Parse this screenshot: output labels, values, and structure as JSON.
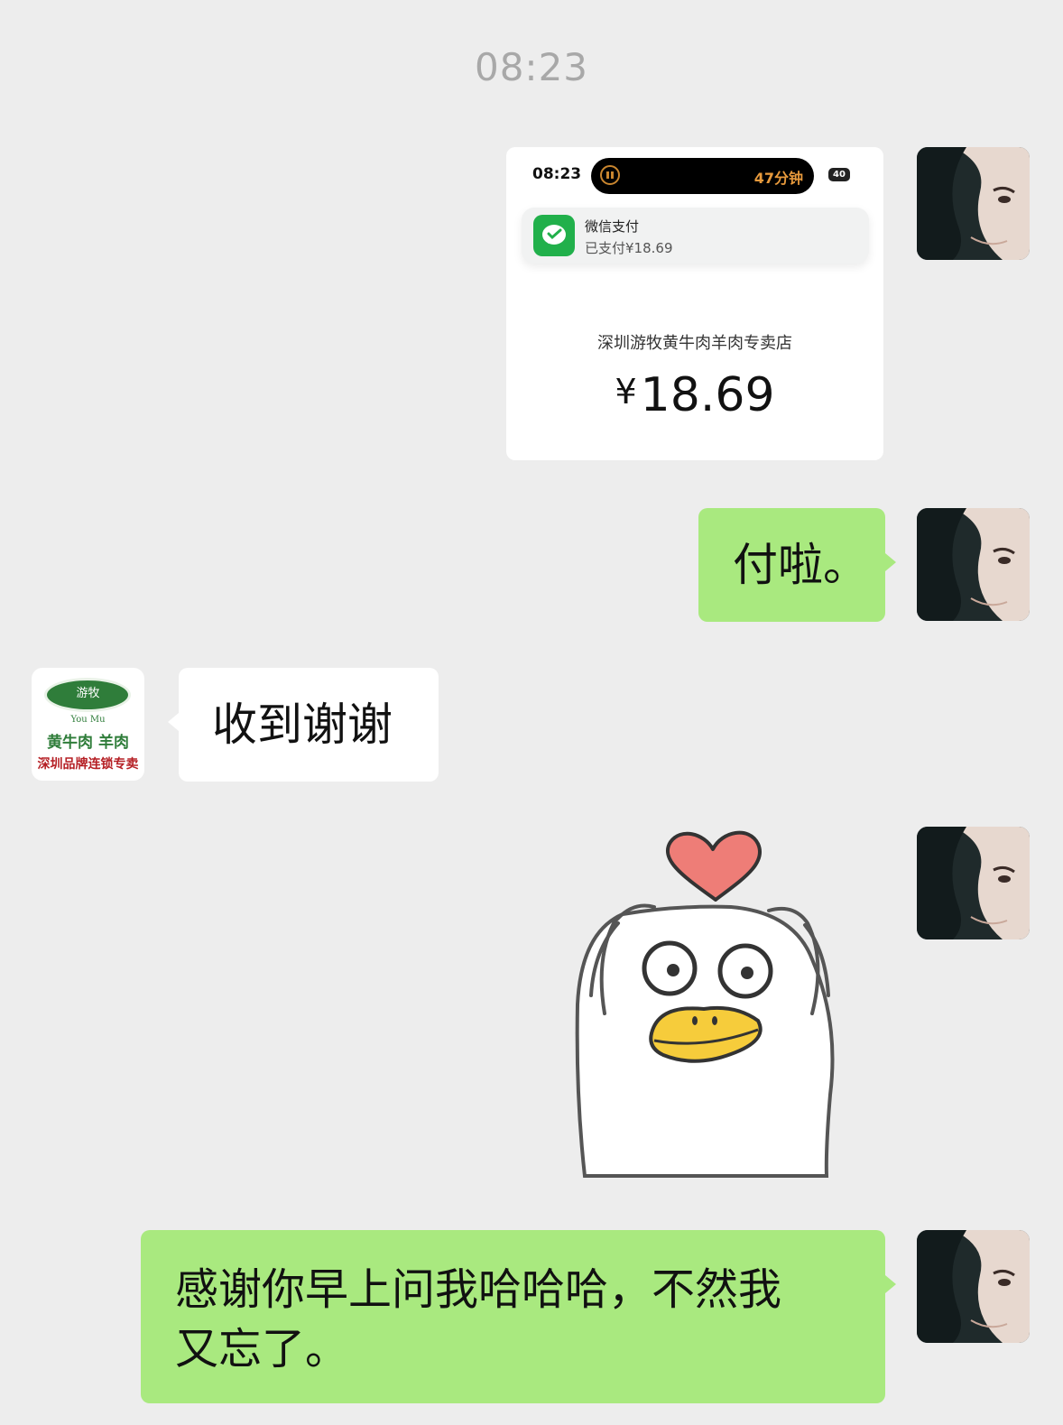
{
  "chat": {
    "timestamp": "08:23",
    "screenshot": {
      "status_time": "08:23",
      "island_timer": "47分钟",
      "battery": "40",
      "notification_title": "微信支付",
      "notification_body": "已支付¥18.69",
      "merchant": "深圳游牧黄牛肉羊肉专卖店",
      "currency": "¥",
      "amount": "18.69"
    },
    "messages": [
      {
        "sender": "me",
        "text": "付啦。"
      },
      {
        "sender": "them",
        "text": "收到谢谢"
      },
      {
        "sender": "me",
        "text": "感谢你早上问我哈哈哈，不然我又忘了。",
        "line1": "感谢你早上问我哈哈哈，不然我",
        "line2": "又忘了。"
      }
    ],
    "merchant_logo": {
      "brand": "游牧",
      "english": "You Mu",
      "line1": "黄牛肉 羊肉",
      "line2": "深圳品牌连锁专卖"
    }
  },
  "colors": {
    "background": "#ededed",
    "my_bubble": "#a9e97f",
    "their_bubble": "#ffffff"
  },
  "icons": [
    "user-avatar",
    "merchant-logo",
    "wechat-pay-icon",
    "duck-heart-sticker"
  ]
}
